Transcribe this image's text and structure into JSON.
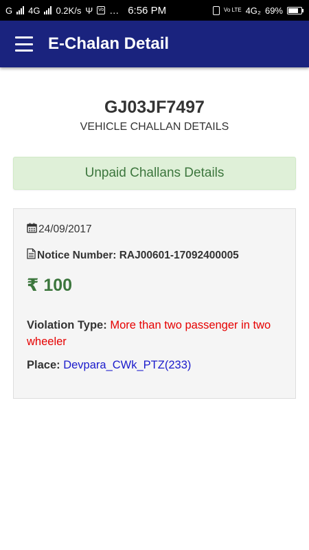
{
  "status_bar": {
    "carrier": "G",
    "network_left": "4G",
    "speed": "0.2K/s",
    "dots": "…",
    "time": "6:56 PM",
    "network_right": "4G₂",
    "volte": "Vo LTE",
    "battery": "69%"
  },
  "app_bar": {
    "title": "E-Chalan Detail"
  },
  "vehicle": {
    "number": "GJ03JF7497",
    "subtitle": "VEHICLE CHALLAN DETAILS"
  },
  "banner": {
    "text": "Unpaid Challans Details"
  },
  "challan": {
    "date": "24/09/2017",
    "notice": "Notice Number: RAJ00601-17092400005",
    "amount": "₹ 100",
    "violation_label": "Violation Type:",
    "violation_value": "More than two passenger in two wheeler",
    "place_label": "Place:",
    "place_value": "Devpara_CWk_PTZ(233)"
  },
  "colors": {
    "app_bar": "#1a237e",
    "banner_bg": "#dff0d8",
    "success_text": "#3c763d",
    "violation": "#e60000",
    "place": "#1a1acc"
  }
}
